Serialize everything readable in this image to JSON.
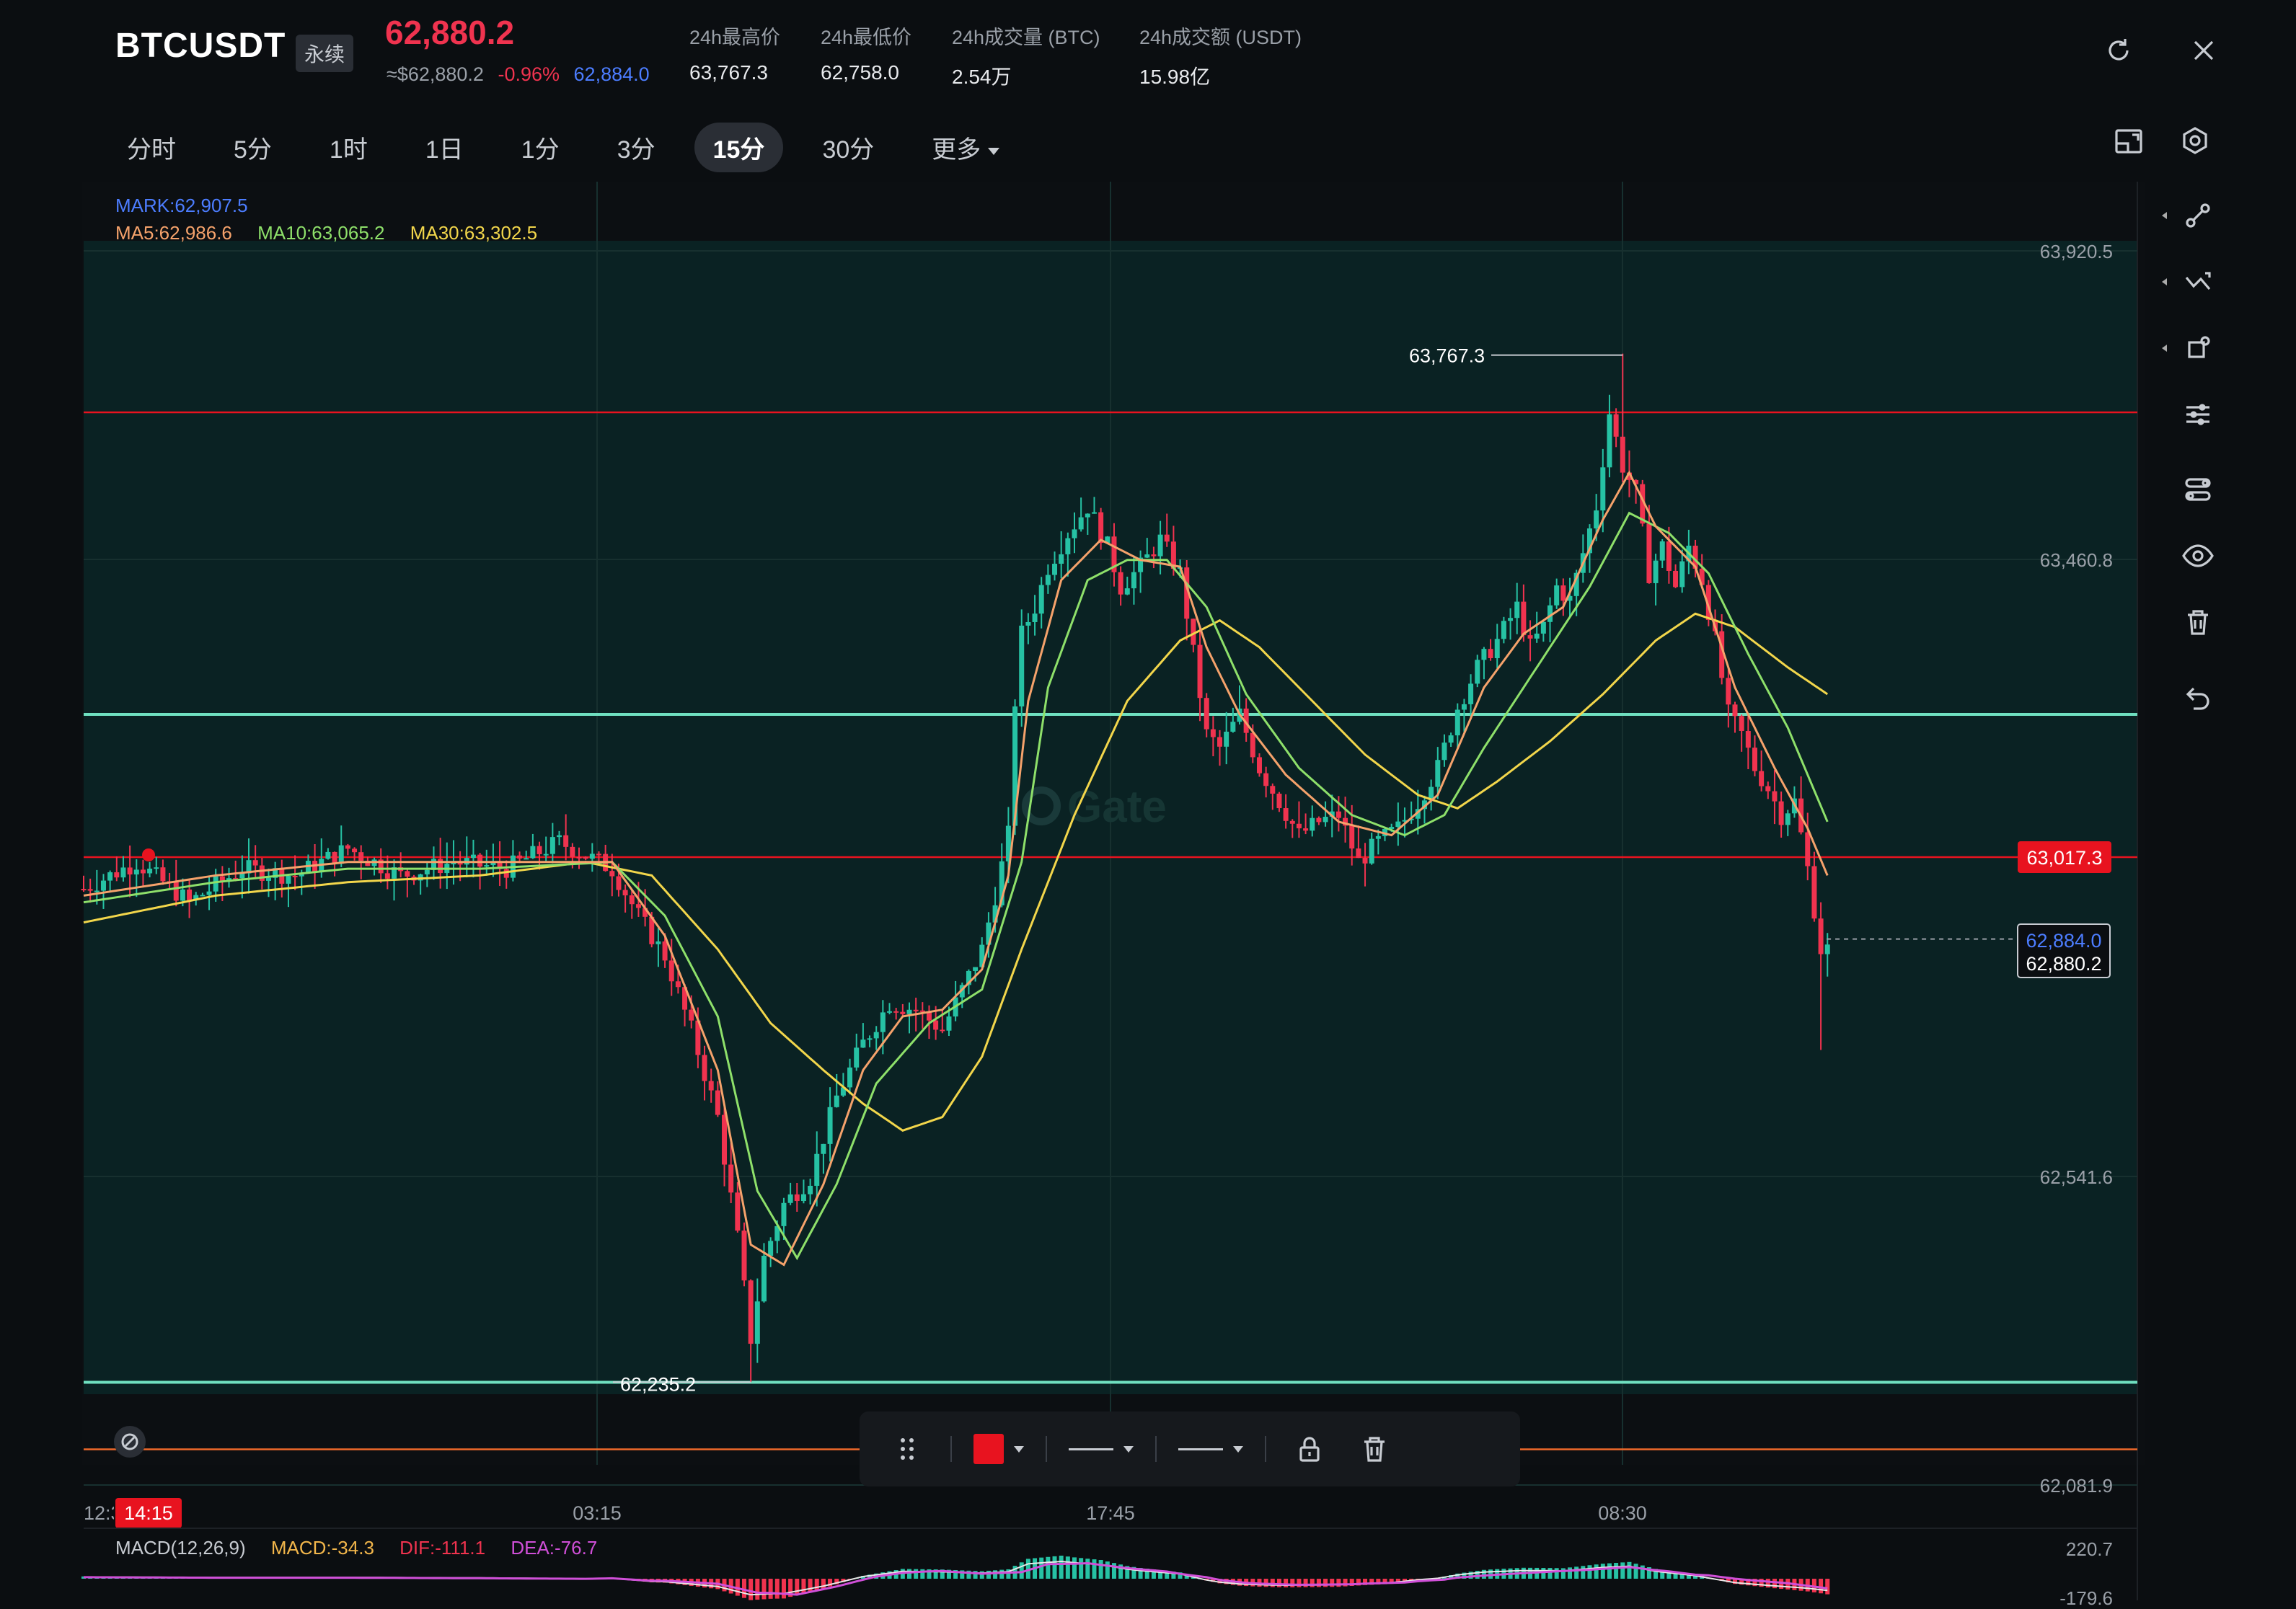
{
  "header": {
    "symbol": "BTCUSDT",
    "contract_type": "永续",
    "last_price": "62,880.2",
    "usd_value": "≈$62,880.2",
    "change_pct": "-0.96%",
    "mark_price": "62,884.0",
    "stats": [
      {
        "label": "24h最高价",
        "value": "63,767.3"
      },
      {
        "label": "24h最低价",
        "value": "62,758.0"
      },
      {
        "label": "24h成交量 (BTC)",
        "value": "2.54万"
      },
      {
        "label": "24h成交额 (USDT)",
        "value": "15.98亿"
      }
    ]
  },
  "tabs": [
    {
      "label": "分时"
    },
    {
      "label": "5分"
    },
    {
      "label": "1时"
    },
    {
      "label": "1日"
    },
    {
      "label": "1分"
    },
    {
      "label": "3分"
    },
    {
      "label": "15分",
      "active": true
    },
    {
      "label": "30分"
    },
    {
      "label": "更多"
    }
  ],
  "legend": {
    "mark": "MARK:62,907.5",
    "ma5": "MA5:62,986.6",
    "ma10": "MA10:63,065.2",
    "ma30": "MA30:63,302.5"
  },
  "macd_legend": {
    "name": "MACD(12,26,9)",
    "macd": "MACD:-34.3",
    "dif": "DIF:-111.1",
    "dea": "DEA:-76.7"
  },
  "colors": {
    "up": "#26c2a4",
    "down": "#f0334f",
    "ma5": "#f5a26b",
    "ma10": "#8ee06a",
    "ma30": "#f2d64b",
    "mark": "#4c7dff",
    "dif": "#e8e8e8",
    "dea": "#d04fd8",
    "hline_red": "#e8131f",
    "hline_teal": "#6fe0c0",
    "hline_orange": "#f06a2a"
  },
  "chart_data": {
    "type": "candlestick",
    "interval": "15分",
    "price_axis_ticks": [
      "63,920.5",
      "63,460.8",
      "62,541.6",
      "62,081.9"
    ],
    "price_axis_values": [
      63920.5,
      63460.8,
      62541.6,
      62081.9
    ],
    "y_range": [
      62081.9,
      63920.5
    ],
    "time_axis_ticks": [
      "12:30",
      "03:15",
      "17:45",
      "08:30"
    ],
    "crosshair_time": "14:15",
    "high_marker": {
      "label": "63,767.3",
      "value": 63767.3
    },
    "low_marker": {
      "label": "62,235.2",
      "value": 62235.2
    },
    "price_labels": [
      {
        "label": "63,017.3",
        "value": 63017.3,
        "kind": "hline"
      },
      {
        "label": "62,884.0",
        "value": 62884.0,
        "kind": "mark"
      },
      {
        "label": "62,880.2",
        "value": 62880.2,
        "kind": "last"
      }
    ],
    "horizontal_lines": [
      {
        "value": 63680,
        "color": "red"
      },
      {
        "value": 63230,
        "color": "teal"
      },
      {
        "value": 63017.3,
        "color": "red"
      },
      {
        "value": 62235,
        "color": "teal"
      },
      {
        "value": 62135,
        "color": "orange"
      }
    ],
    "close_path": [
      [
        0,
        62970
      ],
      [
        8,
        63010
      ],
      [
        16,
        62950
      ],
      [
        24,
        63000
      ],
      [
        32,
        62990
      ],
      [
        40,
        63030
      ],
      [
        48,
        62990
      ],
      [
        56,
        63010
      ],
      [
        64,
        63000
      ],
      [
        72,
        63040
      ],
      [
        80,
        63000
      ],
      [
        84,
        62930
      ],
      [
        88,
        62870
      ],
      [
        92,
        62760
      ],
      [
        96,
        62630
      ],
      [
        99,
        62450
      ],
      [
        101,
        62300
      ],
      [
        103,
        62420
      ],
      [
        106,
        62500
      ],
      [
        110,
        62540
      ],
      [
        114,
        62660
      ],
      [
        118,
        62740
      ],
      [
        122,
        62800
      ],
      [
        126,
        62790
      ],
      [
        130,
        62760
      ],
      [
        133,
        62820
      ],
      [
        136,
        62880
      ],
      [
        138,
        62960
      ],
      [
        140,
        63050
      ],
      [
        141,
        63250
      ],
      [
        142,
        63350
      ],
      [
        144,
        63390
      ],
      [
        146,
        63450
      ],
      [
        149,
        63500
      ],
      [
        152,
        63540
      ],
      [
        155,
        63480
      ],
      [
        157,
        63420
      ],
      [
        160,
        63450
      ],
      [
        163,
        63490
      ],
      [
        166,
        63440
      ],
      [
        168,
        63320
      ],
      [
        170,
        63200
      ],
      [
        172,
        63180
      ],
      [
        175,
        63230
      ],
      [
        178,
        63150
      ],
      [
        181,
        63100
      ],
      [
        184,
        63050
      ],
      [
        187,
        63070
      ],
      [
        190,
        63080
      ],
      [
        193,
        63010
      ],
      [
        196,
        63040
      ],
      [
        199,
        63060
      ],
      [
        202,
        63100
      ],
      [
        205,
        63150
      ],
      [
        208,
        63240
      ],
      [
        211,
        63300
      ],
      [
        214,
        63340
      ],
      [
        217,
        63390
      ],
      [
        219,
        63330
      ],
      [
        221,
        63360
      ],
      [
        223,
        63420
      ],
      [
        225,
        63400
      ],
      [
        227,
        63470
      ],
      [
        229,
        63540
      ],
      [
        231,
        63680
      ],
      [
        233,
        63600
      ],
      [
        235,
        63560
      ],
      [
        237,
        63440
      ],
      [
        239,
        63480
      ],
      [
        241,
        63420
      ],
      [
        243,
        63480
      ],
      [
        245,
        63430
      ],
      [
        247,
        63340
      ],
      [
        249,
        63230
      ],
      [
        251,
        63200
      ],
      [
        253,
        63150
      ],
      [
        255,
        63120
      ],
      [
        257,
        63080
      ],
      [
        259,
        63100
      ],
      [
        261,
        63000
      ],
      [
        263,
        62880
      ]
    ],
    "ma5_path": [
      [
        0,
        62960
      ],
      [
        20,
        62990
      ],
      [
        40,
        63010
      ],
      [
        60,
        63010
      ],
      [
        80,
        63010
      ],
      [
        88,
        62900
      ],
      [
        96,
        62700
      ],
      [
        101,
        62440
      ],
      [
        106,
        62410
      ],
      [
        112,
        62530
      ],
      [
        118,
        62700
      ],
      [
        124,
        62780
      ],
      [
        130,
        62790
      ],
      [
        136,
        62850
      ],
      [
        140,
        62990
      ],
      [
        143,
        63250
      ],
      [
        148,
        63430
      ],
      [
        154,
        63490
      ],
      [
        160,
        63460
      ],
      [
        166,
        63450
      ],
      [
        170,
        63330
      ],
      [
        175,
        63230
      ],
      [
        182,
        63140
      ],
      [
        190,
        63070
      ],
      [
        198,
        63050
      ],
      [
        205,
        63110
      ],
      [
        212,
        63270
      ],
      [
        218,
        63350
      ],
      [
        224,
        63390
      ],
      [
        230,
        63520
      ],
      [
        234,
        63590
      ],
      [
        238,
        63510
      ],
      [
        244,
        63450
      ],
      [
        250,
        63270
      ],
      [
        256,
        63150
      ],
      [
        261,
        63060
      ],
      [
        264,
        62990
      ]
    ],
    "ma10_path": [
      [
        0,
        62950
      ],
      [
        20,
        62980
      ],
      [
        40,
        63000
      ],
      [
        60,
        63000
      ],
      [
        80,
        63010
      ],
      [
        88,
        62930
      ],
      [
        96,
        62780
      ],
      [
        102,
        62520
      ],
      [
        108,
        62420
      ],
      [
        114,
        62530
      ],
      [
        120,
        62680
      ],
      [
        128,
        62770
      ],
      [
        136,
        62820
      ],
      [
        142,
        63010
      ],
      [
        146,
        63270
      ],
      [
        152,
        63430
      ],
      [
        158,
        63460
      ],
      [
        164,
        63460
      ],
      [
        170,
        63390
      ],
      [
        176,
        63260
      ],
      [
        184,
        63150
      ],
      [
        192,
        63080
      ],
      [
        200,
        63050
      ],
      [
        206,
        63080
      ],
      [
        212,
        63180
      ],
      [
        220,
        63300
      ],
      [
        228,
        63420
      ],
      [
        234,
        63530
      ],
      [
        240,
        63500
      ],
      [
        246,
        63440
      ],
      [
        252,
        63320
      ],
      [
        258,
        63210
      ],
      [
        264,
        63070
      ]
    ],
    "ma30_path": [
      [
        0,
        62920
      ],
      [
        20,
        62960
      ],
      [
        40,
        62980
      ],
      [
        60,
        62990
      ],
      [
        76,
        63010
      ],
      [
        86,
        62990
      ],
      [
        96,
        62880
      ],
      [
        104,
        62770
      ],
      [
        112,
        62700
      ],
      [
        118,
        62650
      ],
      [
        124,
        62610
      ],
      [
        130,
        62630
      ],
      [
        136,
        62720
      ],
      [
        142,
        62880
      ],
      [
        150,
        63080
      ],
      [
        158,
        63250
      ],
      [
        166,
        63340
      ],
      [
        172,
        63370
      ],
      [
        178,
        63330
      ],
      [
        186,
        63250
      ],
      [
        194,
        63170
      ],
      [
        202,
        63110
      ],
      [
        208,
        63090
      ],
      [
        214,
        63130
      ],
      [
        222,
        63190
      ],
      [
        230,
        63260
      ],
      [
        238,
        63340
      ],
      [
        244,
        63380
      ],
      [
        250,
        63360
      ],
      [
        258,
        63300
      ],
      [
        264,
        63260
      ]
    ]
  },
  "draw_toolbar": {
    "color": "#e8131f"
  }
}
